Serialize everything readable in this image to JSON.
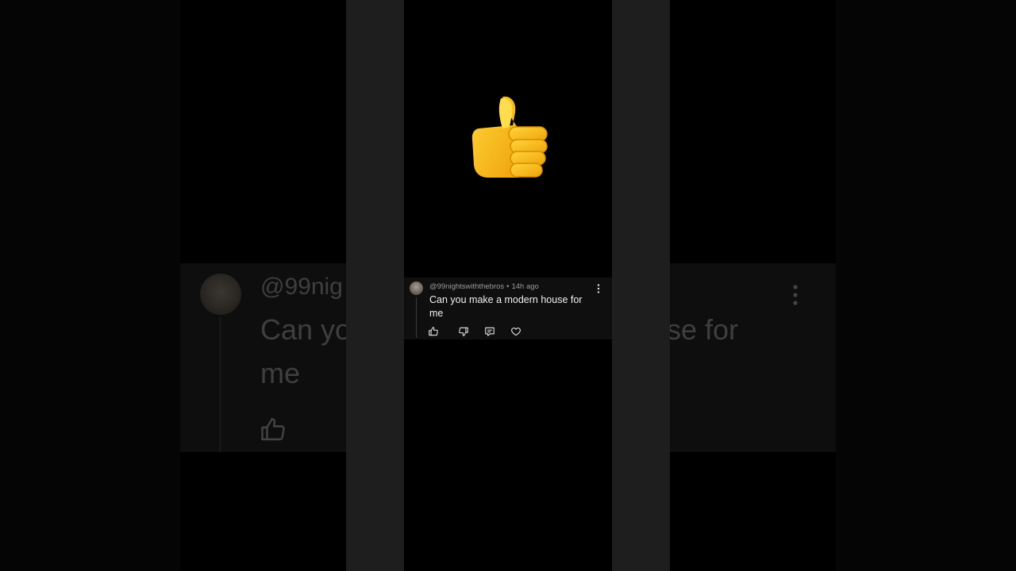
{
  "comment": {
    "username": "@99nightswiththebros",
    "separator": "•",
    "time": "14h ago",
    "text": "Can you make a modern house for me"
  },
  "background_copy": {
    "username_fragment": "@99nig",
    "line1_fragment": "Can yo",
    "line1_tail": "se for",
    "line2": "me"
  },
  "icons": {
    "thumbnail": "thumbs-up-emoji",
    "like": "thumbs-up-icon",
    "dislike": "thumbs-down-icon",
    "reply": "reply-icon",
    "heart": "heart-icon",
    "more": "more-vertical-icon"
  },
  "colors": {
    "background": "#000000",
    "side_bars": "#1e1e1e",
    "comment_bg": "#0f0f0f",
    "emoji_yellow": "#f7c21c"
  }
}
